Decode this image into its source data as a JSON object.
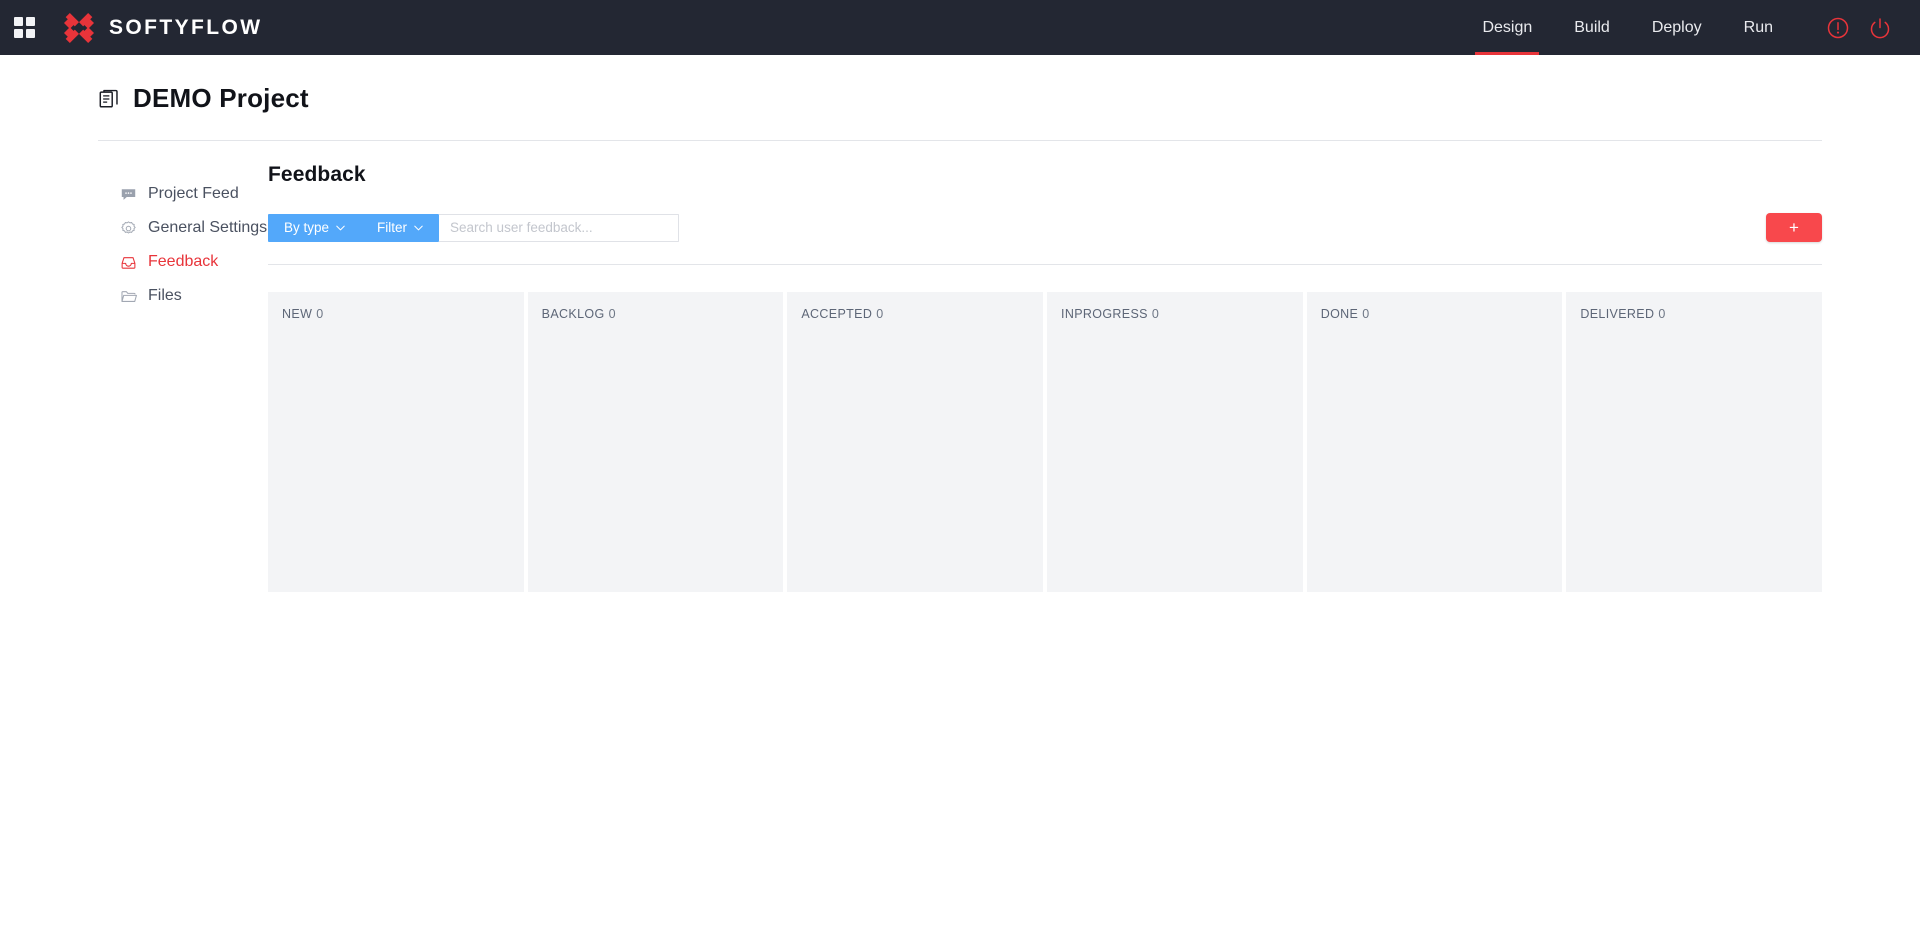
{
  "topbar": {
    "apps_icon": "grid-apps-icon",
    "logo_icon": "softyflow-x-logo-icon",
    "brand": "SOFTYFLOW",
    "nav": [
      {
        "label": "Design",
        "active": true
      },
      {
        "label": "Build",
        "active": false
      },
      {
        "label": "Deploy",
        "active": false
      },
      {
        "label": "Run",
        "active": false
      }
    ],
    "actions": [
      {
        "icon": "alert-circle-icon"
      },
      {
        "icon": "power-icon"
      }
    ],
    "background": "#232733",
    "accent": "#e8343a"
  },
  "page": {
    "icon": "project-document-icon",
    "title": "DEMO Project"
  },
  "sidebar": {
    "items": [
      {
        "label": "Project Feed",
        "icon": "feed-chat-icon",
        "active": false
      },
      {
        "label": "General Settings",
        "icon": "gear-icon",
        "active": false
      },
      {
        "label": "Feedback",
        "icon": "inbox-icon",
        "active": true
      },
      {
        "label": "Files",
        "icon": "folder-icon",
        "active": false
      }
    ]
  },
  "main": {
    "section_title": "Feedback",
    "toolbar": {
      "by_type_label": "By type",
      "filter_label": "Filter",
      "search_placeholder": "Search user feedback...",
      "search_value": "",
      "add_label": "+",
      "filter_bg": "#53a8fa",
      "add_bg": "#f8484c"
    },
    "board": {
      "columns": [
        {
          "name": "NEW",
          "count": "0"
        },
        {
          "name": "BACKLOG",
          "count": "0"
        },
        {
          "name": "ACCEPTED",
          "count": "0"
        },
        {
          "name": "INPROGRESS",
          "count": "0"
        },
        {
          "name": "DONE",
          "count": "0"
        },
        {
          "name": "DELIVERED",
          "count": "0"
        }
      ]
    }
  }
}
